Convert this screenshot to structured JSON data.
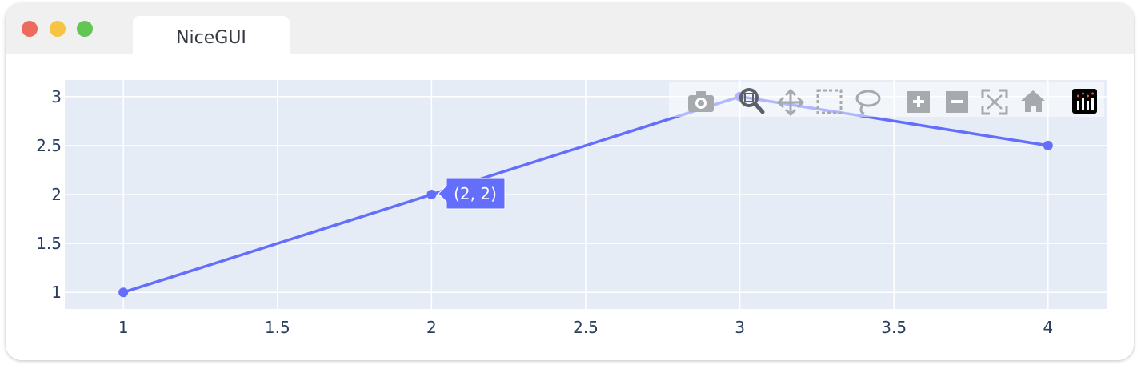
{
  "window": {
    "title": "NiceGUI",
    "controls": [
      {
        "name": "close",
        "color": "#ed6a5e"
      },
      {
        "name": "minimize",
        "color": "#f5c443"
      },
      {
        "name": "maximize",
        "color": "#62c655"
      }
    ]
  },
  "modebar": {
    "buttons": [
      "camera-icon",
      "zoom-icon",
      "pan-icon",
      "box-select-icon",
      "lasso-select-icon",
      "zoom-in-icon",
      "zoom-out-icon",
      "autoscale-icon",
      "reset-axes-icon",
      "plotly-logo-icon"
    ],
    "active": "zoom-icon"
  },
  "tooltip": {
    "text": "(2, 2)"
  },
  "chart_data": {
    "type": "line",
    "x": [
      1,
      2,
      3,
      4
    ],
    "y": [
      1,
      2,
      3,
      2.5
    ],
    "xlim": [
      0.81,
      4.19
    ],
    "ylim": [
      0.83,
      3.17
    ],
    "xticks": [
      1,
      1.5,
      2,
      2.5,
      3,
      3.5,
      4
    ],
    "xtick_labels": [
      "1",
      "1.5",
      "2",
      "2.5",
      "3",
      "3.5",
      "4"
    ],
    "yticks": [
      1,
      1.5,
      2,
      2.5,
      3
    ],
    "ytick_labels": [
      "1",
      "1.5",
      "2",
      "2.5",
      "3"
    ],
    "grid": true,
    "line_color": "#636efa",
    "plot_bg": "#e5ecf6",
    "hovered_point_index": 1
  }
}
